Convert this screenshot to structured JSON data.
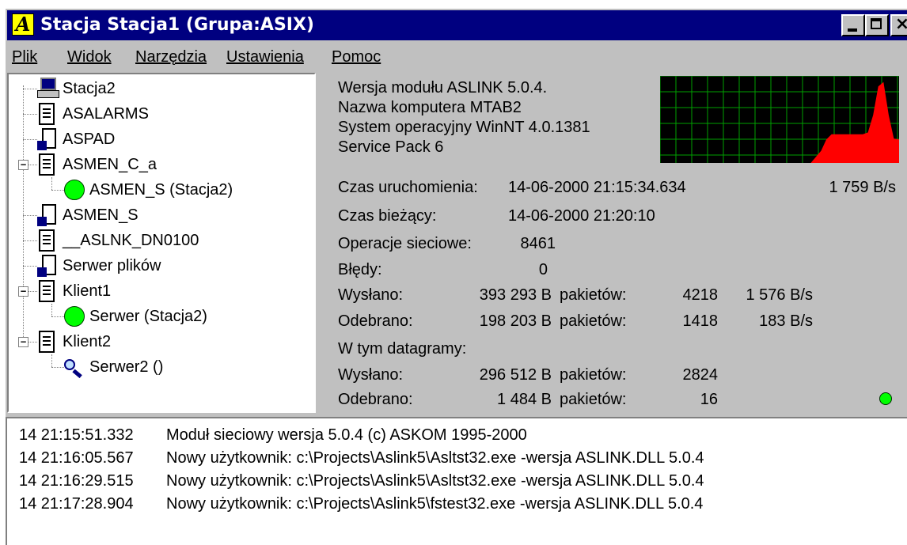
{
  "window": {
    "title": "Stacja Stacja1 (Grupa:ASIX)",
    "app_icon_letter": "A",
    "controls": {
      "minimize_icon": "minimize-icon",
      "maximize_icon": "maximize-icon",
      "close_symbol": "×"
    }
  },
  "menu": [
    "Plik",
    "Widok",
    "Narzędzia",
    "Ustawienia",
    "Pomoc"
  ],
  "tree": {
    "nodes": [
      {
        "label": "Stacja2",
        "icon": "computer-icon",
        "level": 0
      },
      {
        "label": "ASALARMS",
        "icon": "document-icon",
        "level": 0
      },
      {
        "label": "ASPAD",
        "icon": "pad-document-icon",
        "level": 0
      },
      {
        "label": "ASMEN_C_a",
        "icon": "document-icon",
        "level": 0,
        "expanded": true
      },
      {
        "label": "ASMEN_S (Stacja2)",
        "icon": "green-status-icon",
        "level": 1
      },
      {
        "label": "ASMEN_S",
        "icon": "pad-document-icon",
        "level": 0
      },
      {
        "label": "__ASLNK_DN0100",
        "icon": "document-icon",
        "level": 0
      },
      {
        "label": "Serwer plików",
        "icon": "pad-document-icon",
        "level": 0
      },
      {
        "label": "Klient1",
        "icon": "document-icon",
        "level": 0,
        "expanded": true
      },
      {
        "label": "Serwer (Stacja2)",
        "icon": "green-status-icon",
        "level": 1
      },
      {
        "label": "Klient2",
        "icon": "document-icon",
        "level": 0,
        "expanded": true
      },
      {
        "label": "Serwer2 ()",
        "icon": "magnifier-icon",
        "level": 1
      }
    ],
    "expander_symbol": "−"
  },
  "info": {
    "module_version": "Wersja modułu ASLINK 5.0.4.",
    "computer_name": "Nazwa komputera MTAB2",
    "os": "System operacyjny WinNT 4.0.1381",
    "service_pack": "Service Pack 6",
    "start_time_label": "Czas uruchomienia:",
    "start_time_value": "14-06-2000 21:15:34.634",
    "rate": "1 759 B/s",
    "current_time_label": "Czas bieżący:",
    "current_time_value": "14-06-2000 21:20:10",
    "net_ops_label": "Operacje sieciowe:",
    "net_ops_value": "8461",
    "errors_label": "Błędy:",
    "errors_value": "0",
    "sent_label": "Wysłano:",
    "sent_bytes": "393 293 B",
    "sent_packets_label": "pakietów:",
    "sent_packets": "4218",
    "sent_rate": "1 576 B/s",
    "received_label": "Odebrano:",
    "received_bytes": "198 203 B",
    "received_packets_label": "pakietów:",
    "received_packets": "1418",
    "received_rate": "183 B/s",
    "datagrams_label": "W tym datagramy:",
    "dg_sent_label": "Wysłano:",
    "dg_sent_bytes": "296 512 B",
    "dg_sent_packets_label": "pakietów:",
    "dg_sent_packets": "2824",
    "dg_received_label": "Odebrano:",
    "dg_received_bytes": "1 484 B",
    "dg_received_packets_label": "pakietów:",
    "dg_received_packets": "16"
  },
  "graph": {
    "background": "#000000",
    "grid_color": "#00a000",
    "fill_color": "#ff0000",
    "levels": [
      0,
      0,
      0,
      0,
      0,
      0,
      0,
      0,
      0,
      0,
      0,
      0,
      0,
      0,
      0,
      0,
      0,
      0,
      0,
      0,
      0,
      0,
      0,
      0,
      0,
      0,
      0,
      0,
      0,
      0,
      0.07,
      0.14,
      0.27,
      0.33,
      0.33,
      0.33,
      0.33,
      0.33,
      0.33,
      0.33,
      0.35,
      0.55,
      0.88,
      0.93,
      0.55,
      0.28,
      0.27
    ]
  },
  "log": [
    {
      "time": "14 21:15:51.332",
      "message": "Moduł sieciowy wersja 5.0.4 (c) ASKOM 1995-2000"
    },
    {
      "time": "14 21:16:05.567",
      "message": "Nowy użytkownik: c:\\Projects\\Aslink5\\Asltst32.exe -wersja ASLINK.DLL 5.0.4"
    },
    {
      "time": "14 21:16:29.515",
      "message": "Nowy użytkownik: c:\\Projects\\Aslink5\\Asltst32.exe -wersja ASLINK.DLL 5.0.4"
    },
    {
      "time": "14 21:17:28.904",
      "message": "Nowy użytkownik: c:\\Projects\\Aslink5\\fstest32.exe -wersja ASLINK.DLL 5.0.4"
    }
  ],
  "status_indicator_color": "#00ff00"
}
